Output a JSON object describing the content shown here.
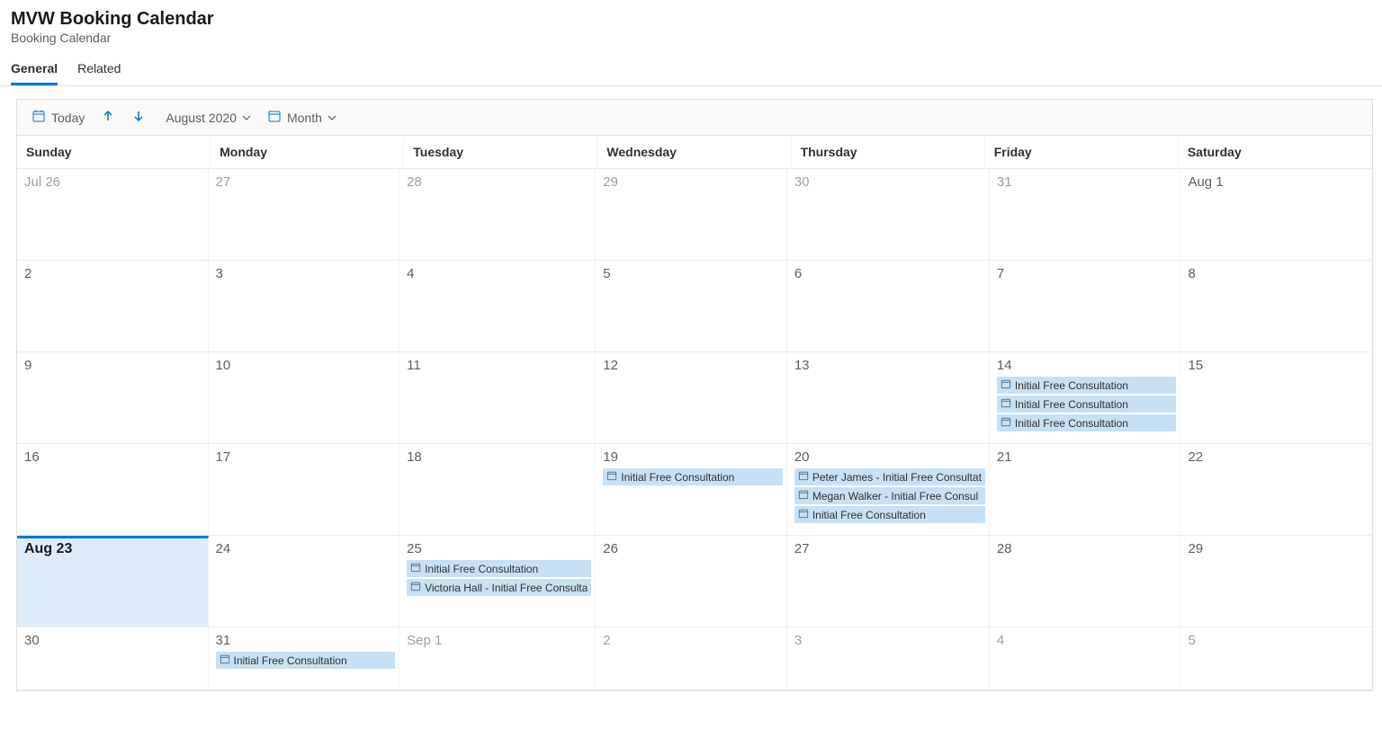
{
  "header": {
    "title": "MVW Booking Calendar",
    "subtitle": "Booking Calendar"
  },
  "tabs": {
    "general": "General",
    "related": "Related"
  },
  "toolbar": {
    "today": "Today",
    "month_label": "August 2020",
    "view_label": "Month"
  },
  "day_headers": [
    "Sunday",
    "Monday",
    "Tuesday",
    "Wednesday",
    "Thursday",
    "Friday",
    "Saturday"
  ],
  "weeks": [
    {
      "short": false,
      "days": [
        {
          "label": "Jul 26",
          "other": true,
          "selected": false,
          "events": []
        },
        {
          "label": "27",
          "other": true,
          "selected": false,
          "events": []
        },
        {
          "label": "28",
          "other": true,
          "selected": false,
          "events": []
        },
        {
          "label": "29",
          "other": true,
          "selected": false,
          "events": []
        },
        {
          "label": "30",
          "other": true,
          "selected": false,
          "events": []
        },
        {
          "label": "31",
          "other": true,
          "selected": false,
          "events": []
        },
        {
          "label": "Aug 1",
          "other": false,
          "selected": false,
          "events": []
        }
      ]
    },
    {
      "short": false,
      "days": [
        {
          "label": "2",
          "other": false,
          "selected": false,
          "events": []
        },
        {
          "label": "3",
          "other": false,
          "selected": false,
          "events": []
        },
        {
          "label": "4",
          "other": false,
          "selected": false,
          "events": []
        },
        {
          "label": "5",
          "other": false,
          "selected": false,
          "events": []
        },
        {
          "label": "6",
          "other": false,
          "selected": false,
          "events": []
        },
        {
          "label": "7",
          "other": false,
          "selected": false,
          "events": []
        },
        {
          "label": "8",
          "other": false,
          "selected": false,
          "events": []
        }
      ]
    },
    {
      "short": false,
      "days": [
        {
          "label": "9",
          "other": false,
          "selected": false,
          "events": []
        },
        {
          "label": "10",
          "other": false,
          "selected": false,
          "events": []
        },
        {
          "label": "11",
          "other": false,
          "selected": false,
          "events": []
        },
        {
          "label": "12",
          "other": false,
          "selected": false,
          "events": []
        },
        {
          "label": "13",
          "other": false,
          "selected": false,
          "events": []
        },
        {
          "label": "14",
          "other": false,
          "selected": false,
          "events": [
            "Initial Free Consultation",
            "Initial Free Consultation",
            "Initial Free Consultation"
          ]
        },
        {
          "label": "15",
          "other": false,
          "selected": false,
          "events": []
        }
      ]
    },
    {
      "short": false,
      "days": [
        {
          "label": "16",
          "other": false,
          "selected": false,
          "events": []
        },
        {
          "label": "17",
          "other": false,
          "selected": false,
          "events": []
        },
        {
          "label": "18",
          "other": false,
          "selected": false,
          "events": []
        },
        {
          "label": "19",
          "other": false,
          "selected": false,
          "events": [
            "Initial Free Consultation"
          ]
        },
        {
          "label": "20",
          "other": false,
          "selected": false,
          "events": [
            "Peter James - Initial Free Consultat",
            "Megan Walker - Initial Free Consul",
            "Initial Free Consultation"
          ]
        },
        {
          "label": "21",
          "other": false,
          "selected": false,
          "events": []
        },
        {
          "label": "22",
          "other": false,
          "selected": false,
          "events": []
        }
      ]
    },
    {
      "short": false,
      "days": [
        {
          "label": "Aug 23",
          "other": false,
          "selected": true,
          "events": []
        },
        {
          "label": "24",
          "other": false,
          "selected": false,
          "events": []
        },
        {
          "label": "25",
          "other": false,
          "selected": false,
          "events": [
            "Initial Free Consultation",
            "Victoria Hall - Initial Free Consulta"
          ]
        },
        {
          "label": "26",
          "other": false,
          "selected": false,
          "events": []
        },
        {
          "label": "27",
          "other": false,
          "selected": false,
          "events": []
        },
        {
          "label": "28",
          "other": false,
          "selected": false,
          "events": []
        },
        {
          "label": "29",
          "other": false,
          "selected": false,
          "events": []
        }
      ]
    },
    {
      "short": true,
      "days": [
        {
          "label": "30",
          "other": false,
          "selected": false,
          "events": []
        },
        {
          "label": "31",
          "other": false,
          "selected": false,
          "events": [
            "Initial Free Consultation"
          ]
        },
        {
          "label": "Sep 1",
          "other": true,
          "selected": false,
          "events": []
        },
        {
          "label": "2",
          "other": true,
          "selected": false,
          "events": []
        },
        {
          "label": "3",
          "other": true,
          "selected": false,
          "events": []
        },
        {
          "label": "4",
          "other": true,
          "selected": false,
          "events": []
        },
        {
          "label": "5",
          "other": true,
          "selected": false,
          "events": []
        }
      ]
    }
  ]
}
